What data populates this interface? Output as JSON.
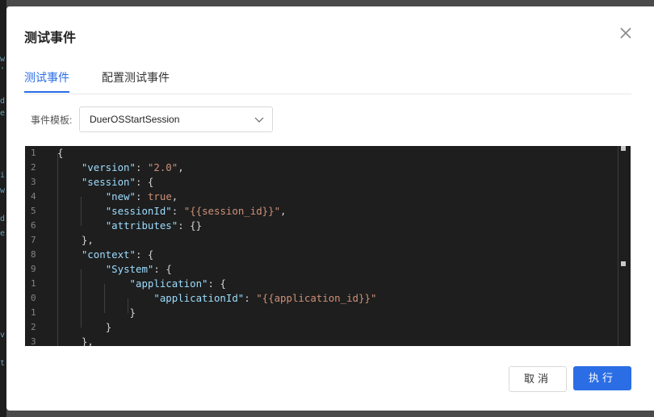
{
  "dialog": {
    "title": "测试事件",
    "tabs": [
      {
        "label": "测试事件",
        "active": true
      },
      {
        "label": "配置测试事件",
        "active": false
      }
    ],
    "template_label": "事件模板:",
    "template_value": "DuerOSStartSession",
    "cancel_label": "取消",
    "run_label": "执行"
  },
  "editor": {
    "line_numbers": [
      "1",
      "2",
      "3",
      "4",
      "5",
      "6",
      "7",
      "8",
      "9",
      "1",
      "0",
      "1",
      "2",
      "3"
    ],
    "lines": [
      "{",
      "    \"version\": \"2.0\",",
      "    \"session\": {",
      "        \"new\": true,",
      "        \"sessionId\": \"{{session_id}}\",",
      "        \"attributes\": {}",
      "    },",
      "    \"context\": {",
      "        \"System\": {",
      "            \"application\": {",
      "                \"applicationId\": \"{{application_id}}\"",
      "            }",
      "        }",
      "    },"
    ]
  },
  "colors": {
    "accent": "#2b6de5",
    "editor_bg": "#1e1e1e",
    "json_key": "#9cdcfe",
    "json_string": "#ce9178",
    "json_bool": "#569cd6"
  },
  "icons": {
    "close": "close-icon",
    "dropdown": "chevron-down-icon"
  }
}
